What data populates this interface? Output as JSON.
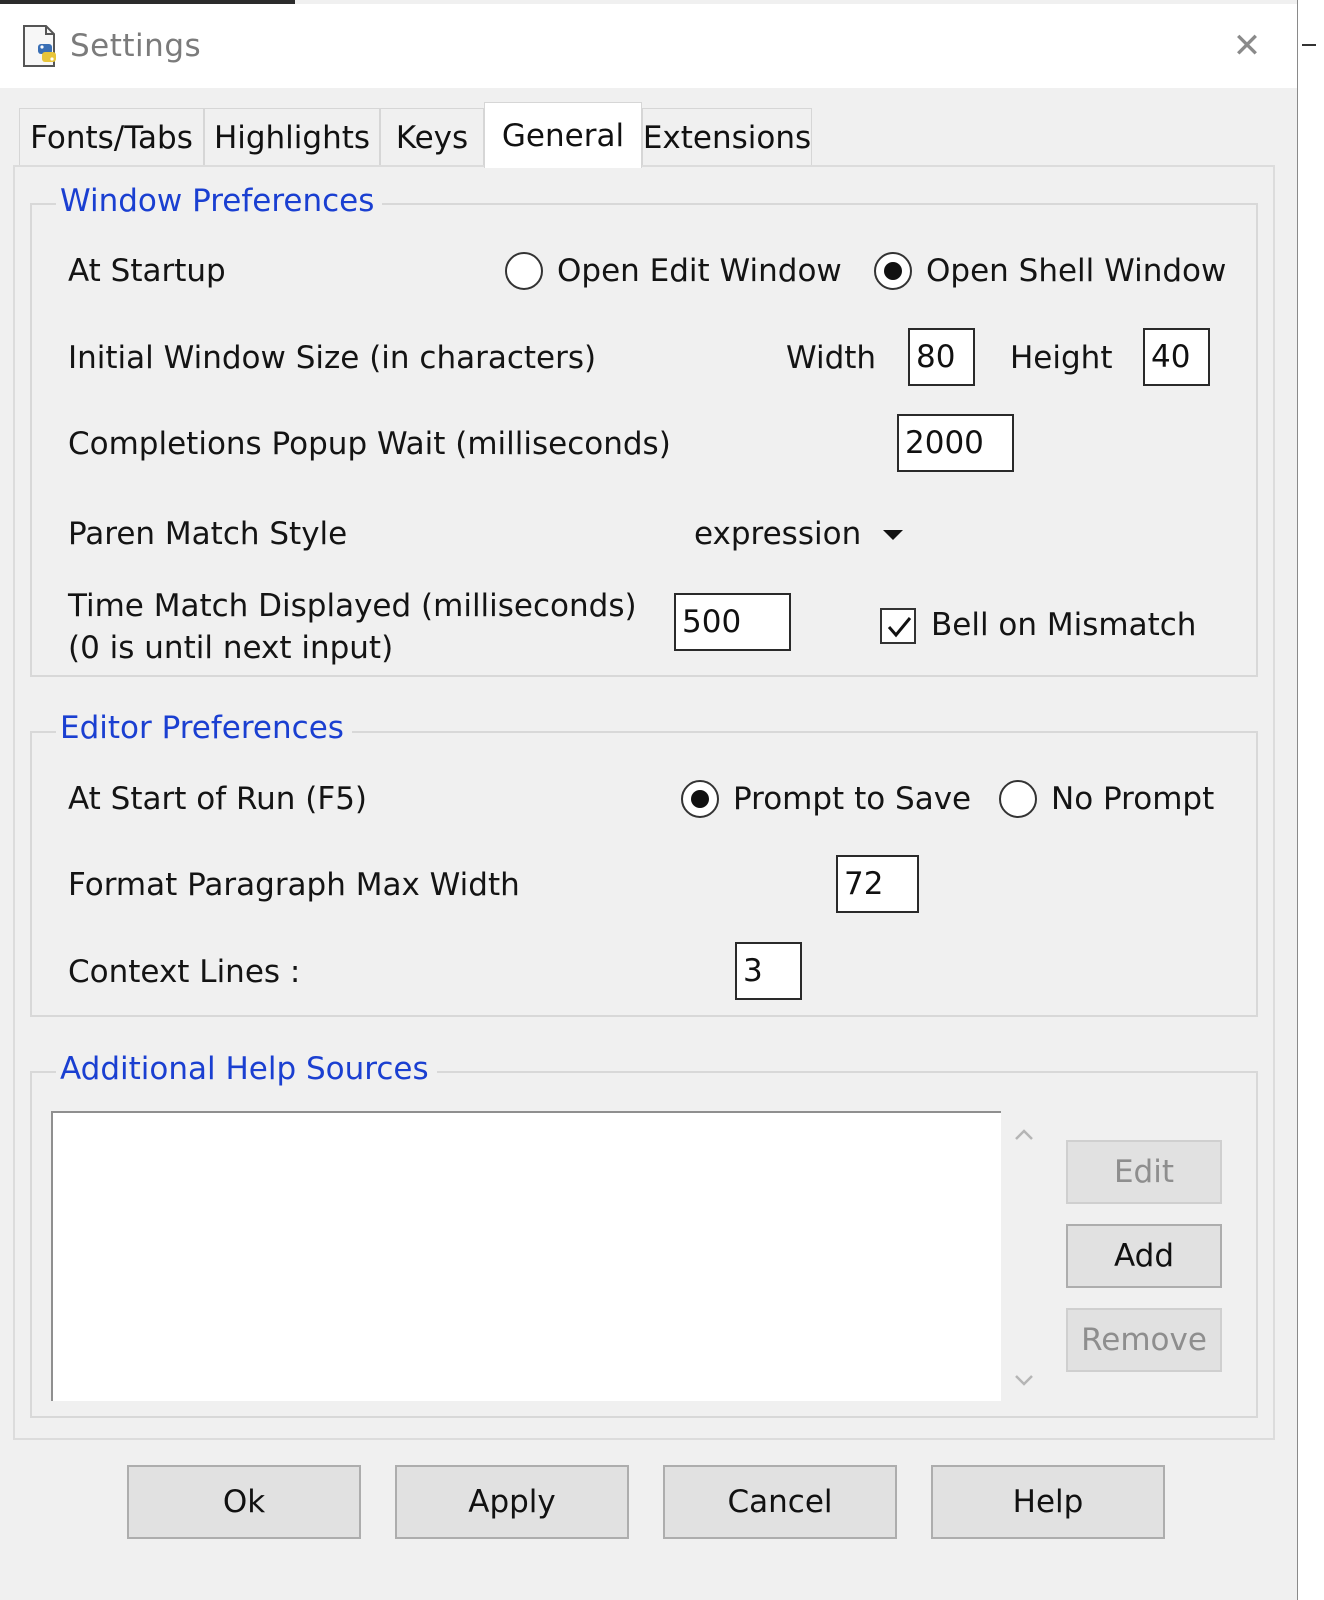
{
  "window": {
    "title": "Settings",
    "close_glyph": "✕",
    "icon": "settings-app-icon"
  },
  "tabs": [
    {
      "label": "Fonts/Tabs",
      "active": false
    },
    {
      "label": "Highlights",
      "active": false
    },
    {
      "label": "Keys",
      "active": false
    },
    {
      "label": "General",
      "active": true
    },
    {
      "label": "Extensions",
      "active": false
    }
  ],
  "window_prefs": {
    "legend": "Window Preferences",
    "startup_label": "At Startup",
    "startup_options": [
      {
        "label": "Open Edit Window",
        "selected": false
      },
      {
        "label": "Open Shell Window",
        "selected": true
      }
    ],
    "size_label": "Initial Window Size  (in characters)",
    "width_label": "Width",
    "width_value": "80",
    "height_label": "Height",
    "height_value": "40",
    "completions_label": "Completions Popup Wait (milliseconds)",
    "completions_value": "2000",
    "paren_label": "Paren Match Style",
    "paren_value": "expression",
    "time_match_label_1": "Time Match Displayed (milliseconds)",
    "time_match_label_2": "(0 is until next input)",
    "time_match_value": "500",
    "bell_label": "Bell on Mismatch",
    "bell_checked": true
  },
  "editor_prefs": {
    "legend": "Editor Preferences",
    "run_label": "At Start of Run (F5)",
    "run_options": [
      {
        "label": "Prompt to Save",
        "selected": true
      },
      {
        "label": "No Prompt",
        "selected": false
      }
    ],
    "format_label": "Format Paragraph Max Width",
    "format_value": "72",
    "context_label": "Context Lines :",
    "context_value": "3"
  },
  "help_sources": {
    "legend": "Additional Help Sources",
    "items": [],
    "edit_label": "Edit",
    "add_label": "Add",
    "remove_label": "Remove"
  },
  "buttons": {
    "ok": "Ok",
    "apply": "Apply",
    "cancel": "Cancel",
    "help": "Help"
  },
  "colors": {
    "legend": "#1a3fd1",
    "background": "#f0f0f0",
    "disabled_text": "#8e8e8e"
  }
}
